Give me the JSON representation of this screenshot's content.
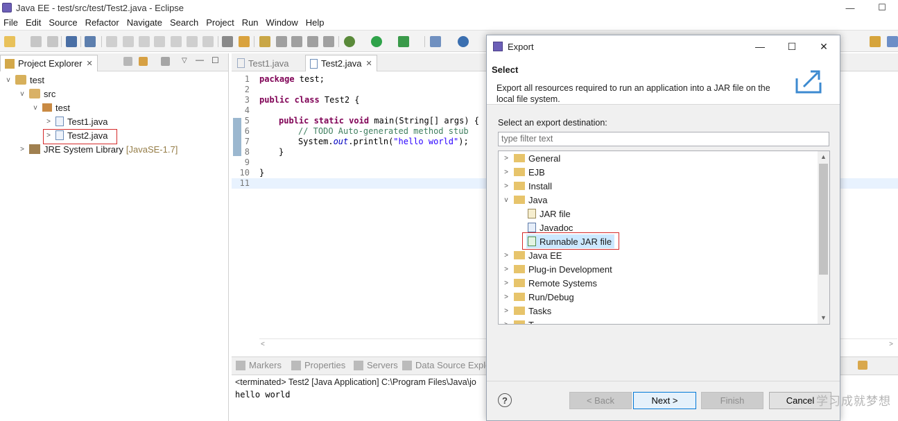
{
  "window": {
    "title": "Java EE - test/src/test/Test2.java - Eclipse",
    "min": "—",
    "max": "☐"
  },
  "menu": [
    "File",
    "Edit",
    "Source",
    "Refactor",
    "Navigate",
    "Search",
    "Project",
    "Run",
    "Window",
    "Help"
  ],
  "project_explorer": {
    "tab_label": "Project Explorer",
    "close": "✕",
    "tree": [
      {
        "label": "test",
        "level": 0,
        "arrow": "v",
        "icon": "project-icon"
      },
      {
        "label": "src",
        "level": 1,
        "arrow": "v",
        "icon": "source-folder-icon"
      },
      {
        "label": "test",
        "level": 2,
        "arrow": "v",
        "icon": "package-icon"
      },
      {
        "label": "Test1.java",
        "level": 3,
        "arrow": ">",
        "icon": "java-file-icon"
      },
      {
        "label": "Test2.java",
        "level": 3,
        "arrow": ">",
        "icon": "java-file-icon"
      },
      {
        "label": "JRE System Library",
        "suffix": "[JavaSE-1.7]",
        "level": 0,
        "arrow": ">",
        "icon": "library-icon"
      }
    ]
  },
  "editor": {
    "tabs": [
      {
        "label": "Test1.java"
      },
      {
        "label": "Test2.java",
        "close": "✕"
      }
    ],
    "line_numbers": [
      "1",
      "2",
      "3",
      "4",
      "5",
      "6",
      "7",
      "8",
      "9",
      "10",
      "11"
    ],
    "code": {
      "l1_kw": "package",
      "l1_rest": " test;",
      "l3_kw": "public class",
      "l3_rest": " Test2 {",
      "l5_kw": "public static void",
      "l5_rest": " main(String[] args) {",
      "l6_comment": "// TODO Auto-generated method stub",
      "l7_pre": "System.",
      "l7_field": "out",
      "l7_mid": ".println(",
      "l7_str": "\"hello world\"",
      "l7_end": ");",
      "l8": "}",
      "l10": "}"
    }
  },
  "console": {
    "tabs": [
      "Markers",
      "Properties",
      "Servers",
      "Data Source Explo"
    ],
    "status": "<terminated> Test2 [Java Application] C:\\Program Files\\Java\\jo",
    "output": "hello world"
  },
  "export_dialog": {
    "title": "Export",
    "heading": "Select",
    "description": "Export all resources required to run an application into a JAR file on the local file system.",
    "label": "Select an export destination:",
    "filter_placeholder": "type filter text",
    "tree": [
      {
        "label": "General",
        "arrow": ">"
      },
      {
        "label": "EJB",
        "arrow": ">"
      },
      {
        "label": "Install",
        "arrow": ">"
      },
      {
        "label": "Java",
        "arrow": "v"
      },
      {
        "label": "JAR file",
        "child": true
      },
      {
        "label": "Javadoc",
        "child": true
      },
      {
        "label": "Runnable JAR file",
        "child": true,
        "selected": true
      },
      {
        "label": "Java EE",
        "arrow": ">"
      },
      {
        "label": "Plug-in Development",
        "arrow": ">"
      },
      {
        "label": "Remote Systems",
        "arrow": ">"
      },
      {
        "label": "Run/Debug",
        "arrow": ">"
      },
      {
        "label": "Tasks",
        "arrow": ">"
      },
      {
        "label": "T",
        "arrow": ">"
      }
    ],
    "buttons": {
      "help": "?",
      "back": "< Back",
      "next": "Next >",
      "finish": "Finish",
      "cancel": "Cancel"
    }
  },
  "watermark": "学习成就梦想"
}
